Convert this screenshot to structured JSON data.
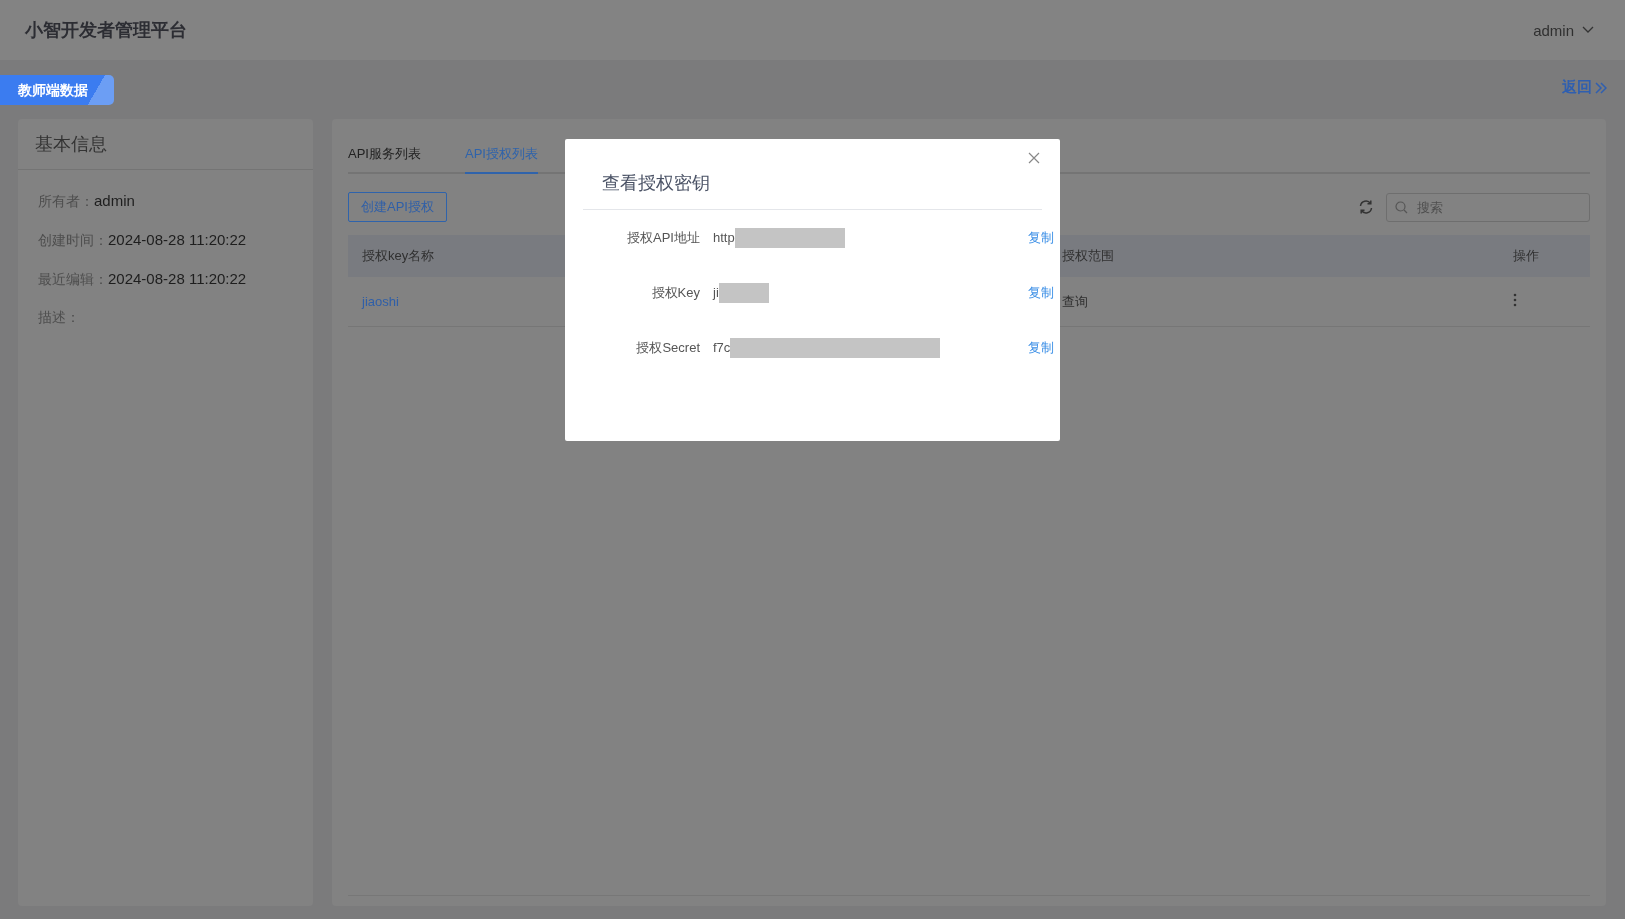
{
  "header": {
    "title": "小智开发者管理平台",
    "user": "admin"
  },
  "tag": "教师端数据",
  "back_link": "返回",
  "info_panel": {
    "title": "基本信息",
    "fields": [
      {
        "label": "所有者：",
        "value": "admin"
      },
      {
        "label": "创建时间：",
        "value": "2024-08-28 11:20:22"
      },
      {
        "label": "最近编辑：",
        "value": "2024-08-28 11:20:22"
      },
      {
        "label": "描述："
      }
    ]
  },
  "tabs": [
    {
      "label": "API服务列表",
      "selected": false
    },
    {
      "label": "API授权列表",
      "selected": true
    }
  ],
  "create_button": "创建API授权",
  "search": {
    "placeholder": "搜索"
  },
  "table": {
    "columns": [
      "授权key名称",
      "授权范围",
      "操作"
    ],
    "rows": [
      {
        "cells": [
          "jiaoshi",
          "查询"
        ]
      }
    ]
  },
  "dialog": {
    "title": "查看授权密钥",
    "fields": [
      {
        "label": "授权API地址",
        "value": "http",
        "copy": "复制"
      },
      {
        "label": "授权Key",
        "value": "ji",
        "copy": "复制"
      },
      {
        "label": "授权Secret",
        "value": "f7c",
        "copy": "复制"
      }
    ]
  }
}
